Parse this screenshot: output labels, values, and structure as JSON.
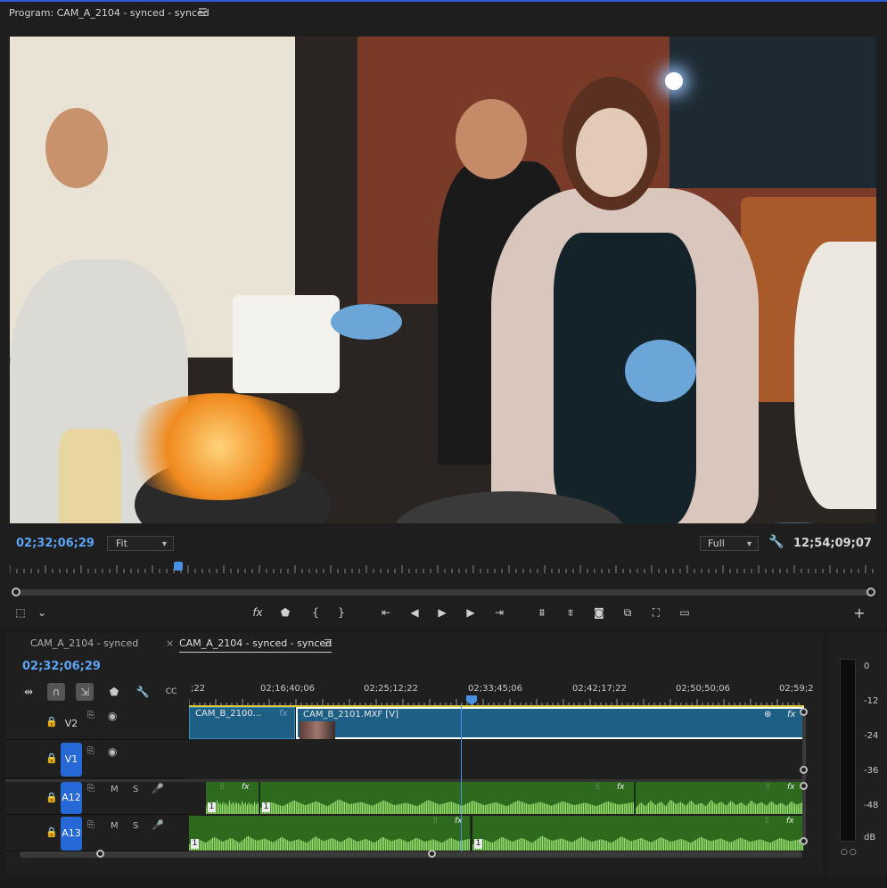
{
  "program": {
    "title": "Program: CAM_A_2104 - synced - synced",
    "timecode_current": "02;32;06;29",
    "zoom": "Fit",
    "resolution": "Full",
    "timecode_duration": "12;54;09;07"
  },
  "transport": {
    "icons": [
      "marker-tool-icon",
      "chevron-down-icon",
      "fx-icon",
      "add-marker-icon",
      "mark-in-icon",
      "mark-out-icon",
      "go-to-in-icon",
      "step-back-icon",
      "play-icon",
      "step-forward-icon",
      "go-to-out-icon",
      "lift-icon",
      "extract-icon",
      "export-frame-icon",
      "compare-icon",
      "vr-icon",
      "multicam-icon",
      "add-button-icon"
    ]
  },
  "timeline": {
    "tabs": [
      {
        "label": "CAM_A_2104 - synced",
        "active": false
      },
      {
        "label": "CAM_A_2104 - synced - synced",
        "active": true
      }
    ],
    "timecode": "02;32;06;29",
    "ruler_labels": [
      ";22",
      "02;16;40;06",
      "02;25;12;22",
      "02;33;45;06",
      "02;42;17;22",
      "02;50;50;06",
      "02;59;2"
    ],
    "tracks": [
      {
        "name": "V2",
        "type": "video",
        "targeted": false,
        "clips": [
          {
            "label": "CAM_B_2100...",
            "fx": "fx"
          },
          {
            "label": "CAM_B_2101.MXF [V]",
            "fx": "fx"
          }
        ]
      },
      {
        "name": "V1",
        "type": "video",
        "targeted": true,
        "clips": []
      },
      {
        "name": "A12",
        "type": "audio",
        "targeted": true,
        "mute": "M",
        "solo": "S",
        "clips": [
          {
            "num": "1",
            "fx": "fx"
          },
          {
            "num": "1",
            "fx": "fx"
          },
          {
            "num": "",
            "fx": "fx"
          }
        ]
      },
      {
        "name": "A13",
        "type": "audio",
        "targeted": true,
        "mute": "M",
        "solo": "S",
        "clips": [
          {
            "num": "1",
            "fx": "fx"
          },
          {
            "num": "1",
            "fx": "fx"
          }
        ]
      }
    ]
  },
  "meter": {
    "labels": [
      "0",
      "-12",
      "-24",
      "-36",
      "-48",
      "dB"
    ],
    "solo": "○○"
  },
  "colors": {
    "accent": "#2d5bd8",
    "timecode": "#5aa3f5",
    "video_clip": "#1e5f86",
    "audio_clip": "#2d6a1e",
    "track_target": "#2568d6"
  }
}
